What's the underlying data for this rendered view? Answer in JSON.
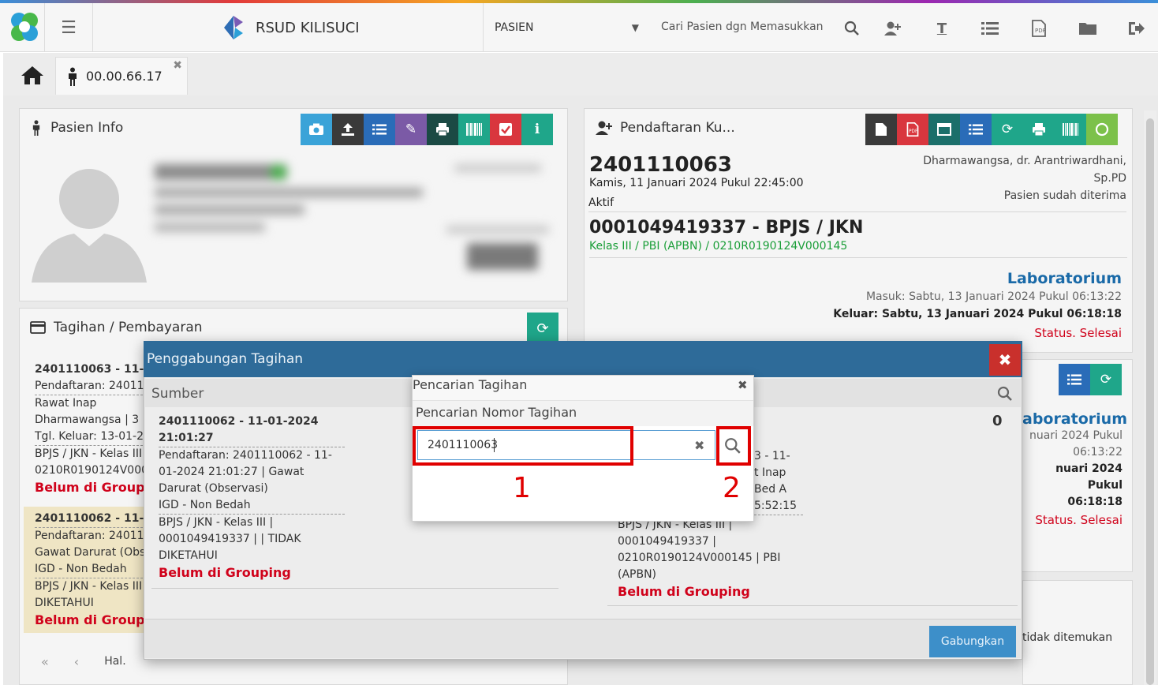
{
  "nav": {
    "brand": "RSUD KILISUCI",
    "select_value": "PASIEN",
    "search_placeholder": "Cari Pasien dgn Memasukkan"
  },
  "tabs": {
    "patient_tab": "00.00.66.17"
  },
  "pasien_info": {
    "title": "Pasien Info"
  },
  "tagihan": {
    "title": "Tagihan / Pembayaran",
    "items": [
      {
        "line1": "2401110063 - 11-01-",
        "line2": "Pendaftaran: 24011",
        "line3": "Rawat Inap",
        "line4": "Dharmawangsa | 3",
        "line5": "Tgl. Keluar: 13-01-2",
        "line6": "BPJS / JKN - Kelas III",
        "line7": "0210R0190124V000",
        "status": "Belum di Groupi"
      },
      {
        "line1": "2401110062 - 11-01-",
        "line2": "Pendaftaran: 24011",
        "line3": "Gawat Darurat (Obs",
        "line4": "IGD - Non Bedah",
        "line5": "BPJS / JKN - Kelas III",
        "line6": "DIKETAHUI",
        "status": "Belum di Groupi"
      }
    ],
    "pager_label": "Hal."
  },
  "pendaftaran": {
    "title": "Pendaftaran Ku...",
    "reg_no": "2401110063",
    "reg_date": "Kamis, 11 Januari 2024 Pukul 22:45:00",
    "doctor_line1": "Dharmawangsa, dr. Arantriwardhani,",
    "doctor_line2": "Sp.PD",
    "received": "Pasien sudah diterima",
    "state": "Aktif",
    "bpjs": "0001049419337 - BPJS / JKN",
    "kelas": "Kelas III / PBI (APBN) / 0210R0190124V000145",
    "unit": "Laboratorium",
    "masuk": "Masuk: Sabtu, 13 Januari 2024 Pukul 06:13:22",
    "keluar": "Keluar: Sabtu, 13 Januari 2024 Pukul 06:18:18",
    "status": "Status. Selesai"
  },
  "second_panel": {
    "count": "0",
    "unit": "aboratorium",
    "l1": "nuari 2024 Pukul",
    "l2": "06:13:22",
    "l3": "nuari 2024 Pukul",
    "l4": "06:18:18",
    "status": "Status. Selesai",
    "notfound": "tidak ditemukan"
  },
  "gabung_modal": {
    "title": "Penggabungan Tagihan",
    "sumber_label": "Sumber",
    "sumber": {
      "line1": "2401110062 - 11-01-2024",
      "line2": "21:01:27",
      "line3": "Pendaftaran: 2401110062 - 11-",
      "line4": "01-2024 21:01:27 | Gawat",
      "line5": "Darurat (Observasi)",
      "line6": "IGD - Non Bedah",
      "line7": "BPJS / JKN - Kelas III |",
      "line8": "0001049419337 | | TIDAK",
      "line9": "DIKETAHUI",
      "status": "Belum di Grouping"
    },
    "target": {
      "line1": "3 - 11-",
      "line2": "t Inap",
      "line3": "Bed A",
      "line4": "5:52:15",
      "line5": "BPJS / JKN - Kelas III |",
      "line6": "0001049419337 |",
      "line7": "0210R0190124V000145 | PBI",
      "line8": "(APBN)",
      "status": "Belum di Grouping"
    },
    "gabungkan": "Gabungkan"
  },
  "search_dialog": {
    "title": "Pencarian Tagihan",
    "label": "Pencarian Nomor Tagihan",
    "input_value": "2401110063",
    "annot_1": "1",
    "annot_2": "2"
  },
  "colors": {
    "modal_header": "#2e6b99",
    "close_red": "#c9302c",
    "highlight": "#e00000",
    "status_red": "#d0021b",
    "green": "#1a9e38"
  }
}
